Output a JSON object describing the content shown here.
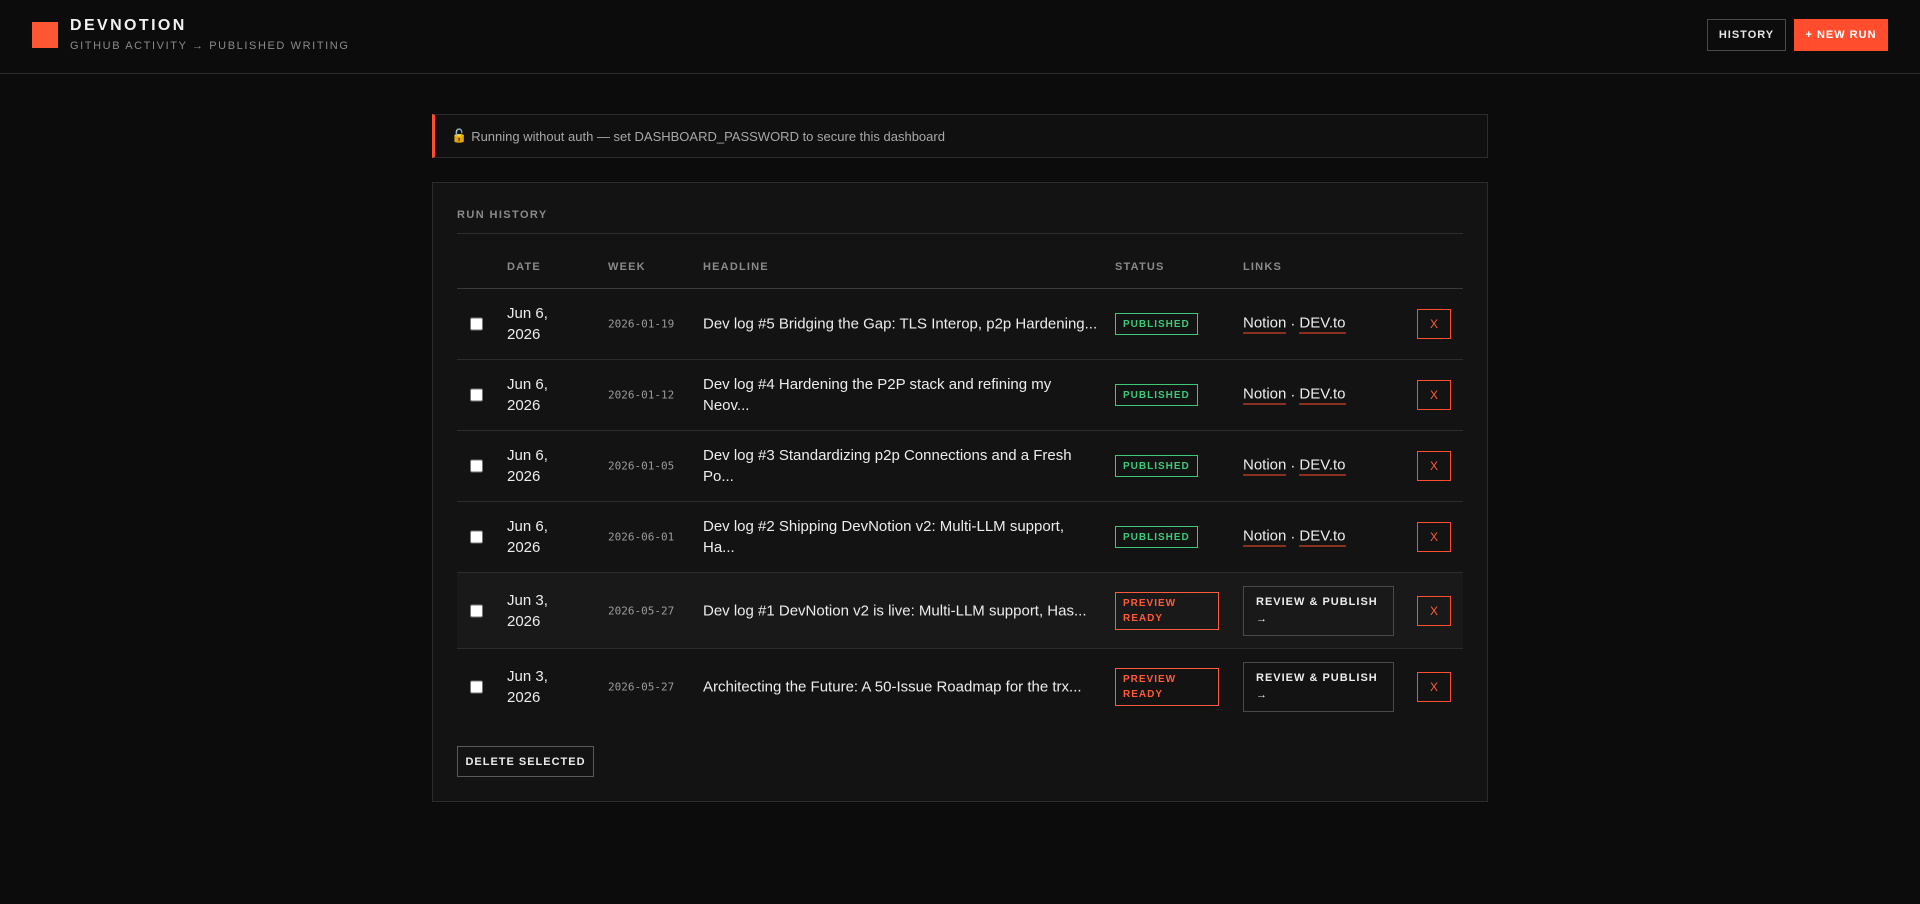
{
  "header": {
    "title": "DEVNOTION",
    "subtitle": "GITHUB ACTIVITY → PUBLISHED WRITING",
    "history_label": "HISTORY",
    "new_run_label": "+ NEW RUN",
    "brand_color": "#ff5733"
  },
  "banner": {
    "icon": "🔓",
    "text": "Running without auth — set DASHBOARD_PASSWORD to secure this dashboard"
  },
  "run_history": {
    "title": "RUN HISTORY",
    "columns": [
      "DATE",
      "WEEK",
      "HEADLINE",
      "STATUS",
      "LINKS"
    ],
    "rows": [
      {
        "date_line1": "Jun 6,",
        "date_line2": "2026",
        "week": "2026-01-19",
        "headline": "Dev log #5 Bridging the Gap: TLS Interop, p2p Hardening...",
        "status": "PUBLISHED",
        "link_notion": "Notion",
        "link_sep": "·",
        "link_dev": "DEV.to",
        "delete": "X"
      },
      {
        "date_line1": "Jun 6,",
        "date_line2": "2026",
        "week": "2026-01-12",
        "headline": "Dev log #4 Hardening the P2P stack and refining my Neov...",
        "status": "PUBLISHED",
        "link_notion": "Notion",
        "link_sep": "·",
        "link_dev": "DEV.to",
        "delete": "X"
      },
      {
        "date_line1": "Jun 6,",
        "date_line2": "2026",
        "week": "2026-01-05",
        "headline": "Dev log #3 Standardizing p2p Connections and a Fresh Po...",
        "status": "PUBLISHED",
        "link_notion": "Notion",
        "link_sep": "·",
        "link_dev": "DEV.to",
        "delete": "X"
      },
      {
        "date_line1": "Jun 6,",
        "date_line2": "2026",
        "week": "2026-06-01",
        "headline": "Dev log #2 Shipping DevNotion v2: Multi-LLM support, Ha...",
        "status": "PUBLISHED",
        "link_notion": "Notion",
        "link_sep": "·",
        "link_dev": "DEV.to",
        "delete": "X"
      },
      {
        "date_line1": "Jun 3,",
        "date_line2": "2026",
        "week": "2026-05-27",
        "headline": "Dev log #1 DevNotion v2 is live: Multi-LLM support, Has...",
        "status_line1": "PREVIEW",
        "status_line2": "READY",
        "review_line1": "REVIEW & PUBLISH",
        "review_line2": "→",
        "delete": "X"
      },
      {
        "date_line1": "Jun 3,",
        "date_line2": "2026",
        "week": "2026-05-27",
        "headline": "Architecting the Future: A 50-Issue Roadmap for the trx...",
        "status_line1": "PREVIEW",
        "status_line2": "READY",
        "review_line1": "REVIEW & PUBLISH",
        "review_line2": "→",
        "delete": "X"
      }
    ],
    "delete_selected_label": "DELETE SELECTED"
  },
  "colors": {
    "accent": "#ff4d2e",
    "published": "#3ec97a",
    "preview": "#ff5a3a"
  }
}
